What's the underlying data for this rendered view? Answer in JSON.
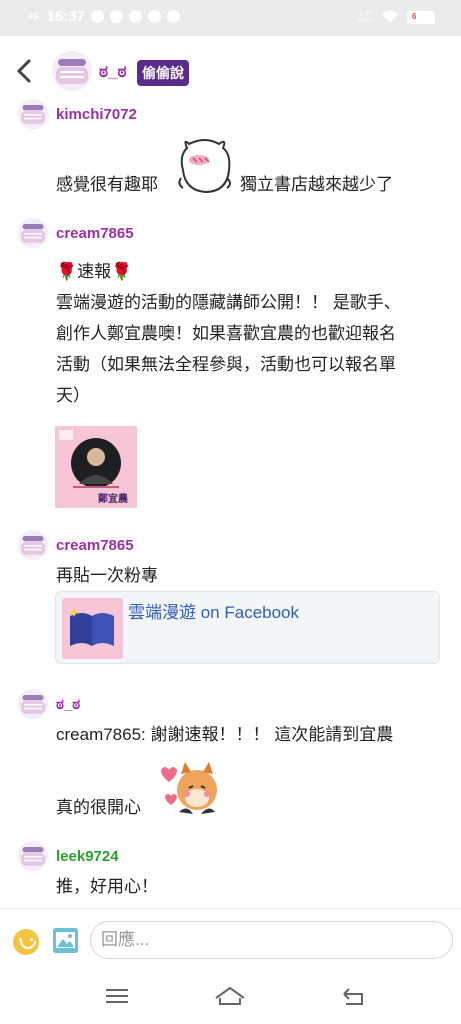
{
  "status_bar": {
    "network": "4G",
    "time": "16:37",
    "speed_value": "1.50",
    "speed_unit": "KB/s",
    "battery": "6"
  },
  "header": {
    "title": "ಠ_ಠ",
    "badge": "偷偷說"
  },
  "comments": [
    {
      "author": "kimchi7072",
      "text_before_sticker": "感覺很有趣耶",
      "text_after_sticker": "獨立書店越來越少了"
    },
    {
      "author": "cream7865",
      "lines": [
        "🌹速報🌹",
        "雲端漫遊的活動的隱藏講師公開！！ 是歌手、",
        "創作人鄭宜農噢！如果喜歡宜農的也歡迎報名",
        "活動（如果無法全程參與，活動也可以報名單",
        "天）"
      ],
      "image_caption": "鄭宜農"
    },
    {
      "author": "cream7865",
      "text": "再貼一次粉專",
      "link_title": "雲端漫遊 on Facebook"
    },
    {
      "author": "ಠ_ಠ",
      "text": "cream7865: 謝謝速報！！！ 這次能請到宜農",
      "text2": "真的很開心"
    },
    {
      "author": "leek9724",
      "text": "推，好用心！"
    }
  ],
  "reply": {
    "placeholder": "回應..."
  },
  "icons": {
    "back": "chevron-left-icon",
    "emoji": "smile-icon",
    "image": "image-icon",
    "menu": "menu-icon",
    "home": "home-icon",
    "return": "return-icon"
  },
  "colors": {
    "author_purple": "#9c2fa8",
    "author_green": "#2aa12a",
    "badge_bg": "#5a2a8c",
    "link_blue": "#2f5fb5"
  }
}
